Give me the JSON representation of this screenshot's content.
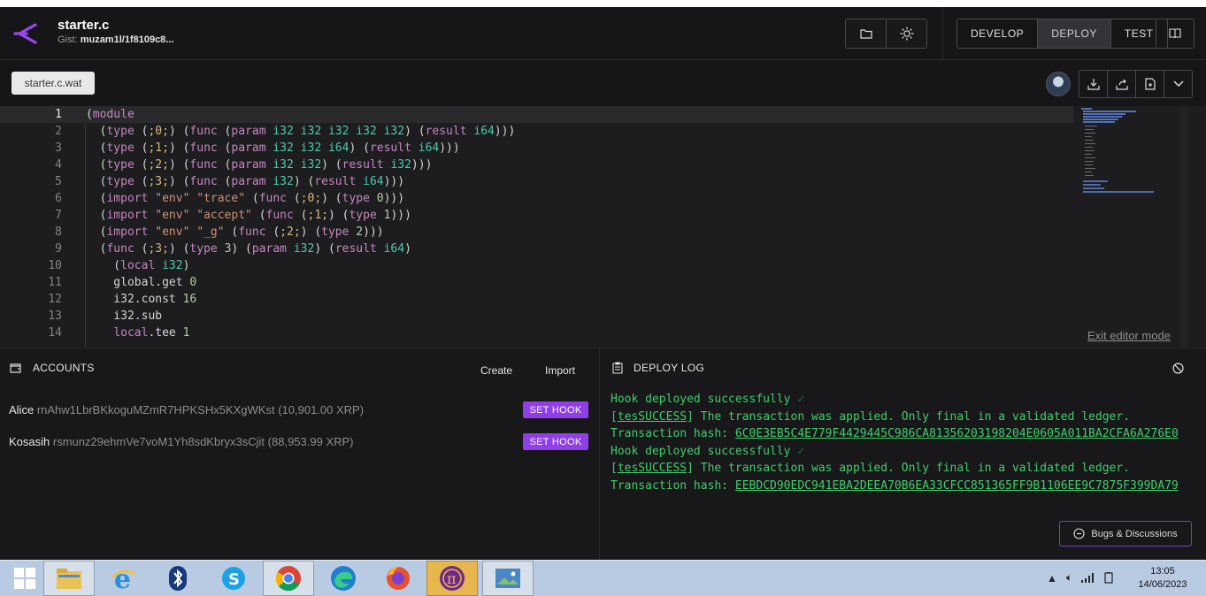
{
  "header": {
    "title": "starter.c",
    "gist_label": "Gist:",
    "gist_value": "muzam1l/1f8109c8...",
    "modes": [
      "DEVELOP",
      "DEPLOY",
      "TEST"
    ],
    "active_mode": "DEPLOY"
  },
  "editor": {
    "file_tab": "starter.c.wat",
    "exit_label": "Exit editor mode",
    "lines": [
      {
        "n": "1",
        "t": "(module"
      },
      {
        "n": "2",
        "t": "  (type (;0;) (func (param i32 i32 i32 i32 i32) (result i64)))"
      },
      {
        "n": "3",
        "t": "  (type (;1;) (func (param i32 i32 i64) (result i64)))"
      },
      {
        "n": "4",
        "t": "  (type (;2;) (func (param i32 i32) (result i32)))"
      },
      {
        "n": "5",
        "t": "  (type (;3;) (func (param i32) (result i64)))"
      },
      {
        "n": "6",
        "t": "  (import \"env\" \"trace\" (func (;0;) (type 0)))"
      },
      {
        "n": "7",
        "t": "  (import \"env\" \"accept\" (func (;1;) (type 1)))"
      },
      {
        "n": "8",
        "t": "  (import \"env\" \"_g\" (func (;2;) (type 2)))"
      },
      {
        "n": "9",
        "t": "  (func (;3;) (type 3) (param i32) (result i64)"
      },
      {
        "n": "10",
        "t": "    (local i32)"
      },
      {
        "n": "11",
        "t": "    global.get 0"
      },
      {
        "n": "12",
        "t": "    i32.const 16"
      },
      {
        "n": "13",
        "t": "    i32.sub"
      },
      {
        "n": "14",
        "t": "    local.tee 1"
      }
    ]
  },
  "accounts": {
    "title": "ACCOUNTS",
    "create_label": "Create",
    "import_label": "Import",
    "items": [
      {
        "name": "Alice",
        "address": "rnAhw1LbrBKkoguMZmR7HPKSHx5KXgWKst",
        "balance": "(10,901.00 XRP)",
        "button": "SET HOOK"
      },
      {
        "name": "Kosasih",
        "address": "rsmunz29ehmVe7voM1Yh8sdKbryx3sCjit",
        "balance": "(88,953.99 XRP)",
        "button": "SET HOOK"
      }
    ]
  },
  "deploy_log": {
    "title": "DEPLOY LOG",
    "deployed_1": "Hook deployed successfully",
    "result_code_1": "tesSUCCESS",
    "result_msg_1": "The transaction was applied. Only final in a validated ledger. Transaction hash:",
    "hash_1": "6C0E3EB5C4E779F4429445C986CA81356203198204E0605A011BA2CFA6A276E0",
    "deployed_2": "Hook deployed successfully",
    "result_code_2": "tesSUCCESS",
    "result_msg_2": "The transaction was applied. Only final in a validated ledger. Transaction hash:",
    "hash_2": "EEBDCD90EDC941EBA2DEEA70B6EA33CFCC851365FF9B1106EE9C7875F399DA79",
    "bugs_label": "Bugs & Discussions"
  },
  "taskbar": {
    "time": "13:05",
    "date": "14/06/2023",
    "apps": [
      "start-icon",
      "file-explorer-icon",
      "internet-explorer-icon",
      "bluetooth-icon",
      "skype-icon",
      "chrome-icon",
      "edge-icon",
      "firefox-icon",
      "pi-network-icon",
      "photos-icon"
    ]
  },
  "colors": {
    "accent": "#8f3ee8",
    "log_green": "#3fcf6a",
    "background": "#161618"
  }
}
